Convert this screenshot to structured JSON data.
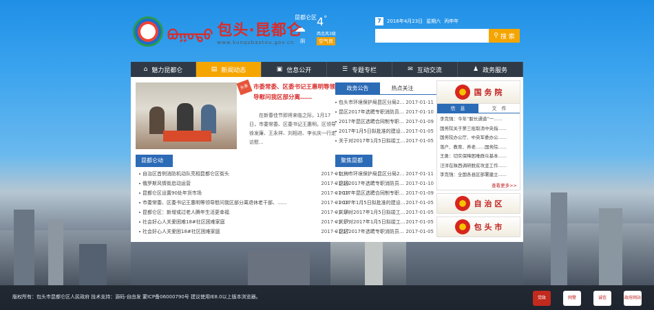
{
  "brand": {
    "mongol": "ᠪᠤᠭᠤᠲᠤ",
    "name": "包头·昆都仑",
    "url": "www.kunqubaotou.gov.cn"
  },
  "weather": {
    "city": "昆都仑区",
    "temp": "4",
    "unit": "°",
    "wind": "西北风3级",
    "cond": "阴",
    "aqi": "空气良"
  },
  "date": {
    "text": "2016年4月23日",
    "weekday": "星期六",
    "lunar": "丙申年",
    "cal": "7"
  },
  "search": {
    "placeholder": "",
    "button": "搜 索"
  },
  "nav": [
    {
      "label": "魅力昆都仑",
      "icon": "home-icon",
      "glyph": "⌂"
    },
    {
      "label": "新闻动态",
      "icon": "news-icon",
      "glyph": "▤"
    },
    {
      "label": "信息公开",
      "icon": "document-icon",
      "glyph": "▣"
    },
    {
      "label": "专题专栏",
      "icon": "list-icon",
      "glyph": "☰"
    },
    {
      "label": "互动交流",
      "icon": "chat-icon",
      "glyph": "✉"
    },
    {
      "label": "政务服务",
      "icon": "user-icon",
      "glyph": "♟"
    }
  ],
  "headline": {
    "ribbon": "头条",
    "title": "市委常委、区委书记王惠明等领导慰问我区部分离……",
    "summary": "在新春佳节即将来临之际，1月17日，市委常委、区委书记王惠明，区领导徐发廉、王永祥、刘相进、李长庆一行走访慰..."
  },
  "tabs": {
    "announce": "政务公告",
    "hot": "热点关注"
  },
  "announce": [
    {
      "t": "包头市环境保护局昆区分局2016年",
      "d": "2017-01-11"
    },
    {
      "t": "昆区2017年选聘专职消防员公告",
      "d": "2017-01-10"
    },
    {
      "t": "2017年昆区选聘合同制专职消防...",
      "d": "2017-01-09"
    },
    {
      "t": "2017年1月5日拟批准的建设项目...",
      "d": "2017-01-05"
    },
    {
      "t": "关于对2017年1月5日拟竣工验收...",
      "d": "2017-01-05"
    }
  ],
  "local": {
    "title": "昆都仑动态",
    "items": [
      {
        "t": "自治区首例消防机动队亮相昆都仑区街头",
        "d": "2017-01-19"
      },
      {
        "t": "俄罗斯风情街启动运营",
        "d": "2017-01-19"
      },
      {
        "t": "昆都仑区设置90处年货市场",
        "d": "2017-01-19"
      },
      {
        "t": "市委常委、区委书记王惠明等领导慰问我区部分离退休老干部、......",
        "d": "2017-01-18"
      },
      {
        "t": "昆都仑区：新增或过老人腾年生活更幸福",
        "d": "2017-01-18"
      },
      {
        "t": "社会好心人关爱困难18#社区困难家庭",
        "d": "2017-01-17"
      },
      {
        "t": "社会好心人关爱困18#社区困难家庭",
        "d": "2017-01-17"
      }
    ]
  },
  "focus": {
    "title": "聚焦昆都仑",
    "items": [
      {
        "t": "包头市环境保护局昆区分局2016年",
        "d": "2017-01-11"
      },
      {
        "t": "昆区2017年选聘专职消防员公告",
        "d": "2017-01-10"
      },
      {
        "t": "2017年昆区选聘合同制专职消防...",
        "d": "2017-01-09"
      },
      {
        "t": "2017年1月5日拟批准的建设项目...",
        "d": "2017-01-05"
      },
      {
        "t": "关于对2017年1月5日拟竣工验收...",
        "d": "2017-01-05"
      },
      {
        "t": "关于对2017年1月5日拟竣工验收...",
        "d": "2017-01-05"
      },
      {
        "t": "昆区2017年选聘专职消防员公告",
        "d": "2017-01-05"
      }
    ]
  },
  "gov": {
    "name": "国 务 院",
    "tab1": "信　息",
    "tab2": "文　件",
    "items": [
      "李克强：今年“服长通道”一......",
      "国务院关于第三批取消中央指......",
      "国务院办公厅、中央军委办公......",
      "落户、教育、养老……国务院......",
      "王勇：切实保障困难群众基本......",
      "汪洋在陕西调研脱贫攻坚工作......",
      "李克强：全国各县区部署建立......"
    ],
    "more": "查看更多>>",
    "region": "自 治 区",
    "city": "包 头 市"
  },
  "footer": {
    "text": "版权所有：包头市昆都仑区人民政府   技术支持：源码-自由发      蒙ICP备06000790号   建议使用IE8.0以上版本浏览器。",
    "badges": [
      "党政",
      "网警",
      "诚信",
      "政府网站"
    ]
  }
}
